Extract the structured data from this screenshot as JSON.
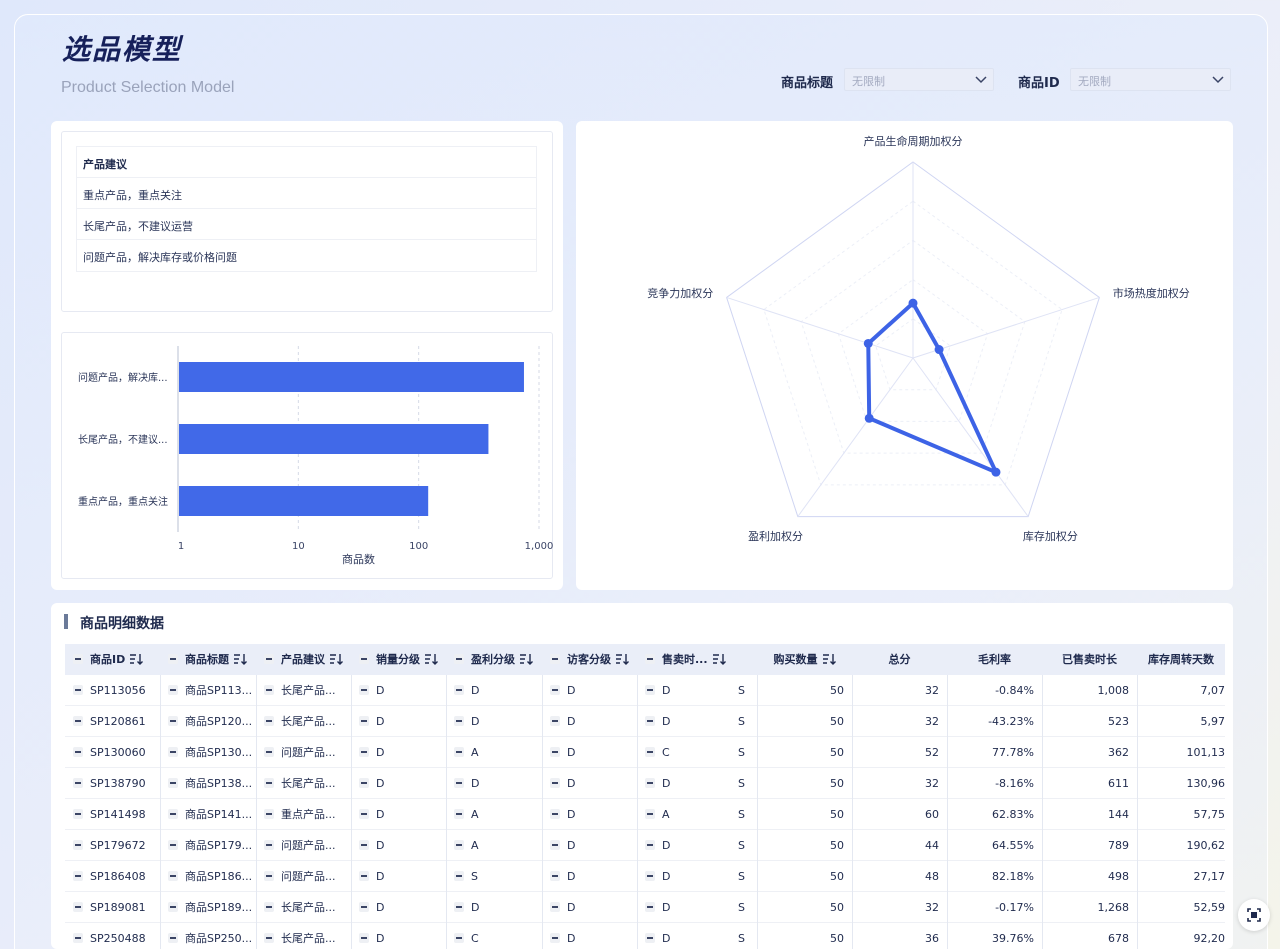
{
  "header": {
    "title": "选品模型",
    "subtitle": "Product Selection Model"
  },
  "filters": [
    {
      "label": "商品标题",
      "value": "无限制"
    },
    {
      "label": "商品ID",
      "value": "无限制"
    }
  ],
  "advice_table": {
    "header": "产品建议",
    "rows": [
      "重点产品，重点关注",
      "长尾产品，不建议运营",
      "问题产品，解决库存或价格问题"
    ]
  },
  "bar_chart": {
    "type": "bar",
    "orientation": "horizontal",
    "x_scale": "log",
    "categories": [
      "问题产品，解决库...",
      "长尾产品，不建议...",
      "重点产品，重点关注"
    ],
    "values": [
      750,
      380,
      120
    ],
    "xlabel": "商品数",
    "x_ticks": [
      "1",
      "10",
      "100",
      "1,000"
    ],
    "color": "#4169e8"
  },
  "radar_chart": {
    "type": "radar",
    "axes": [
      "产品生命周期加权分",
      "市场热度加权分",
      "库存加权分",
      "盈利加权分",
      "竞争力加权分"
    ],
    "values": [
      0.28,
      0.14,
      0.72,
      0.38,
      0.24
    ],
    "max": 1,
    "color": "#3d63e6"
  },
  "detail": {
    "title": "商品明细数据",
    "columns": [
      "商品ID",
      "商品标题",
      "产品建议",
      "销量分级",
      "盈利分级",
      "访客分级",
      "售卖时...",
      "",
      "购买数量",
      "总分",
      "毛利率",
      "已售卖时长",
      "库存周转天数"
    ],
    "rows": [
      [
        "SP113056",
        "商品SP113...",
        "长尾产品...",
        "D",
        "D",
        "D",
        "D",
        "S",
        "50",
        "32",
        "-0.84%",
        "1,008",
        "7,07"
      ],
      [
        "SP120861",
        "商品SP120...",
        "长尾产品...",
        "D",
        "D",
        "D",
        "D",
        "S",
        "50",
        "32",
        "-43.23%",
        "523",
        "5,97"
      ],
      [
        "SP130060",
        "商品SP130...",
        "问题产品...",
        "D",
        "A",
        "D",
        "C",
        "S",
        "50",
        "52",
        "77.78%",
        "362",
        "101,13"
      ],
      [
        "SP138790",
        "商品SP138...",
        "长尾产品...",
        "D",
        "D",
        "D",
        "D",
        "S",
        "50",
        "32",
        "-8.16%",
        "611",
        "130,96"
      ],
      [
        "SP141498",
        "商品SP141...",
        "重点产品...",
        "D",
        "A",
        "D",
        "A",
        "S",
        "50",
        "60",
        "62.83%",
        "144",
        "57,75"
      ],
      [
        "SP179672",
        "商品SP179...",
        "问题产品...",
        "D",
        "A",
        "D",
        "D",
        "S",
        "50",
        "44",
        "64.55%",
        "789",
        "190,62"
      ],
      [
        "SP186408",
        "商品SP186...",
        "问题产品...",
        "D",
        "S",
        "D",
        "D",
        "S",
        "50",
        "48",
        "82.18%",
        "498",
        "27,17"
      ],
      [
        "SP189081",
        "商品SP189...",
        "长尾产品...",
        "D",
        "D",
        "D",
        "D",
        "S",
        "50",
        "32",
        "-0.17%",
        "1,268",
        "52,59"
      ],
      [
        "SP250488",
        "商品SP250...",
        "长尾产品...",
        "D",
        "C",
        "D",
        "D",
        "S",
        "50",
        "36",
        "39.76%",
        "678",
        "92,20"
      ]
    ]
  },
  "icons": {
    "filter_chevron": "chevron-down-icon",
    "sort": "sort-icon",
    "collapse": "minus-icon",
    "fullscreen": "fullscreen-icon"
  }
}
